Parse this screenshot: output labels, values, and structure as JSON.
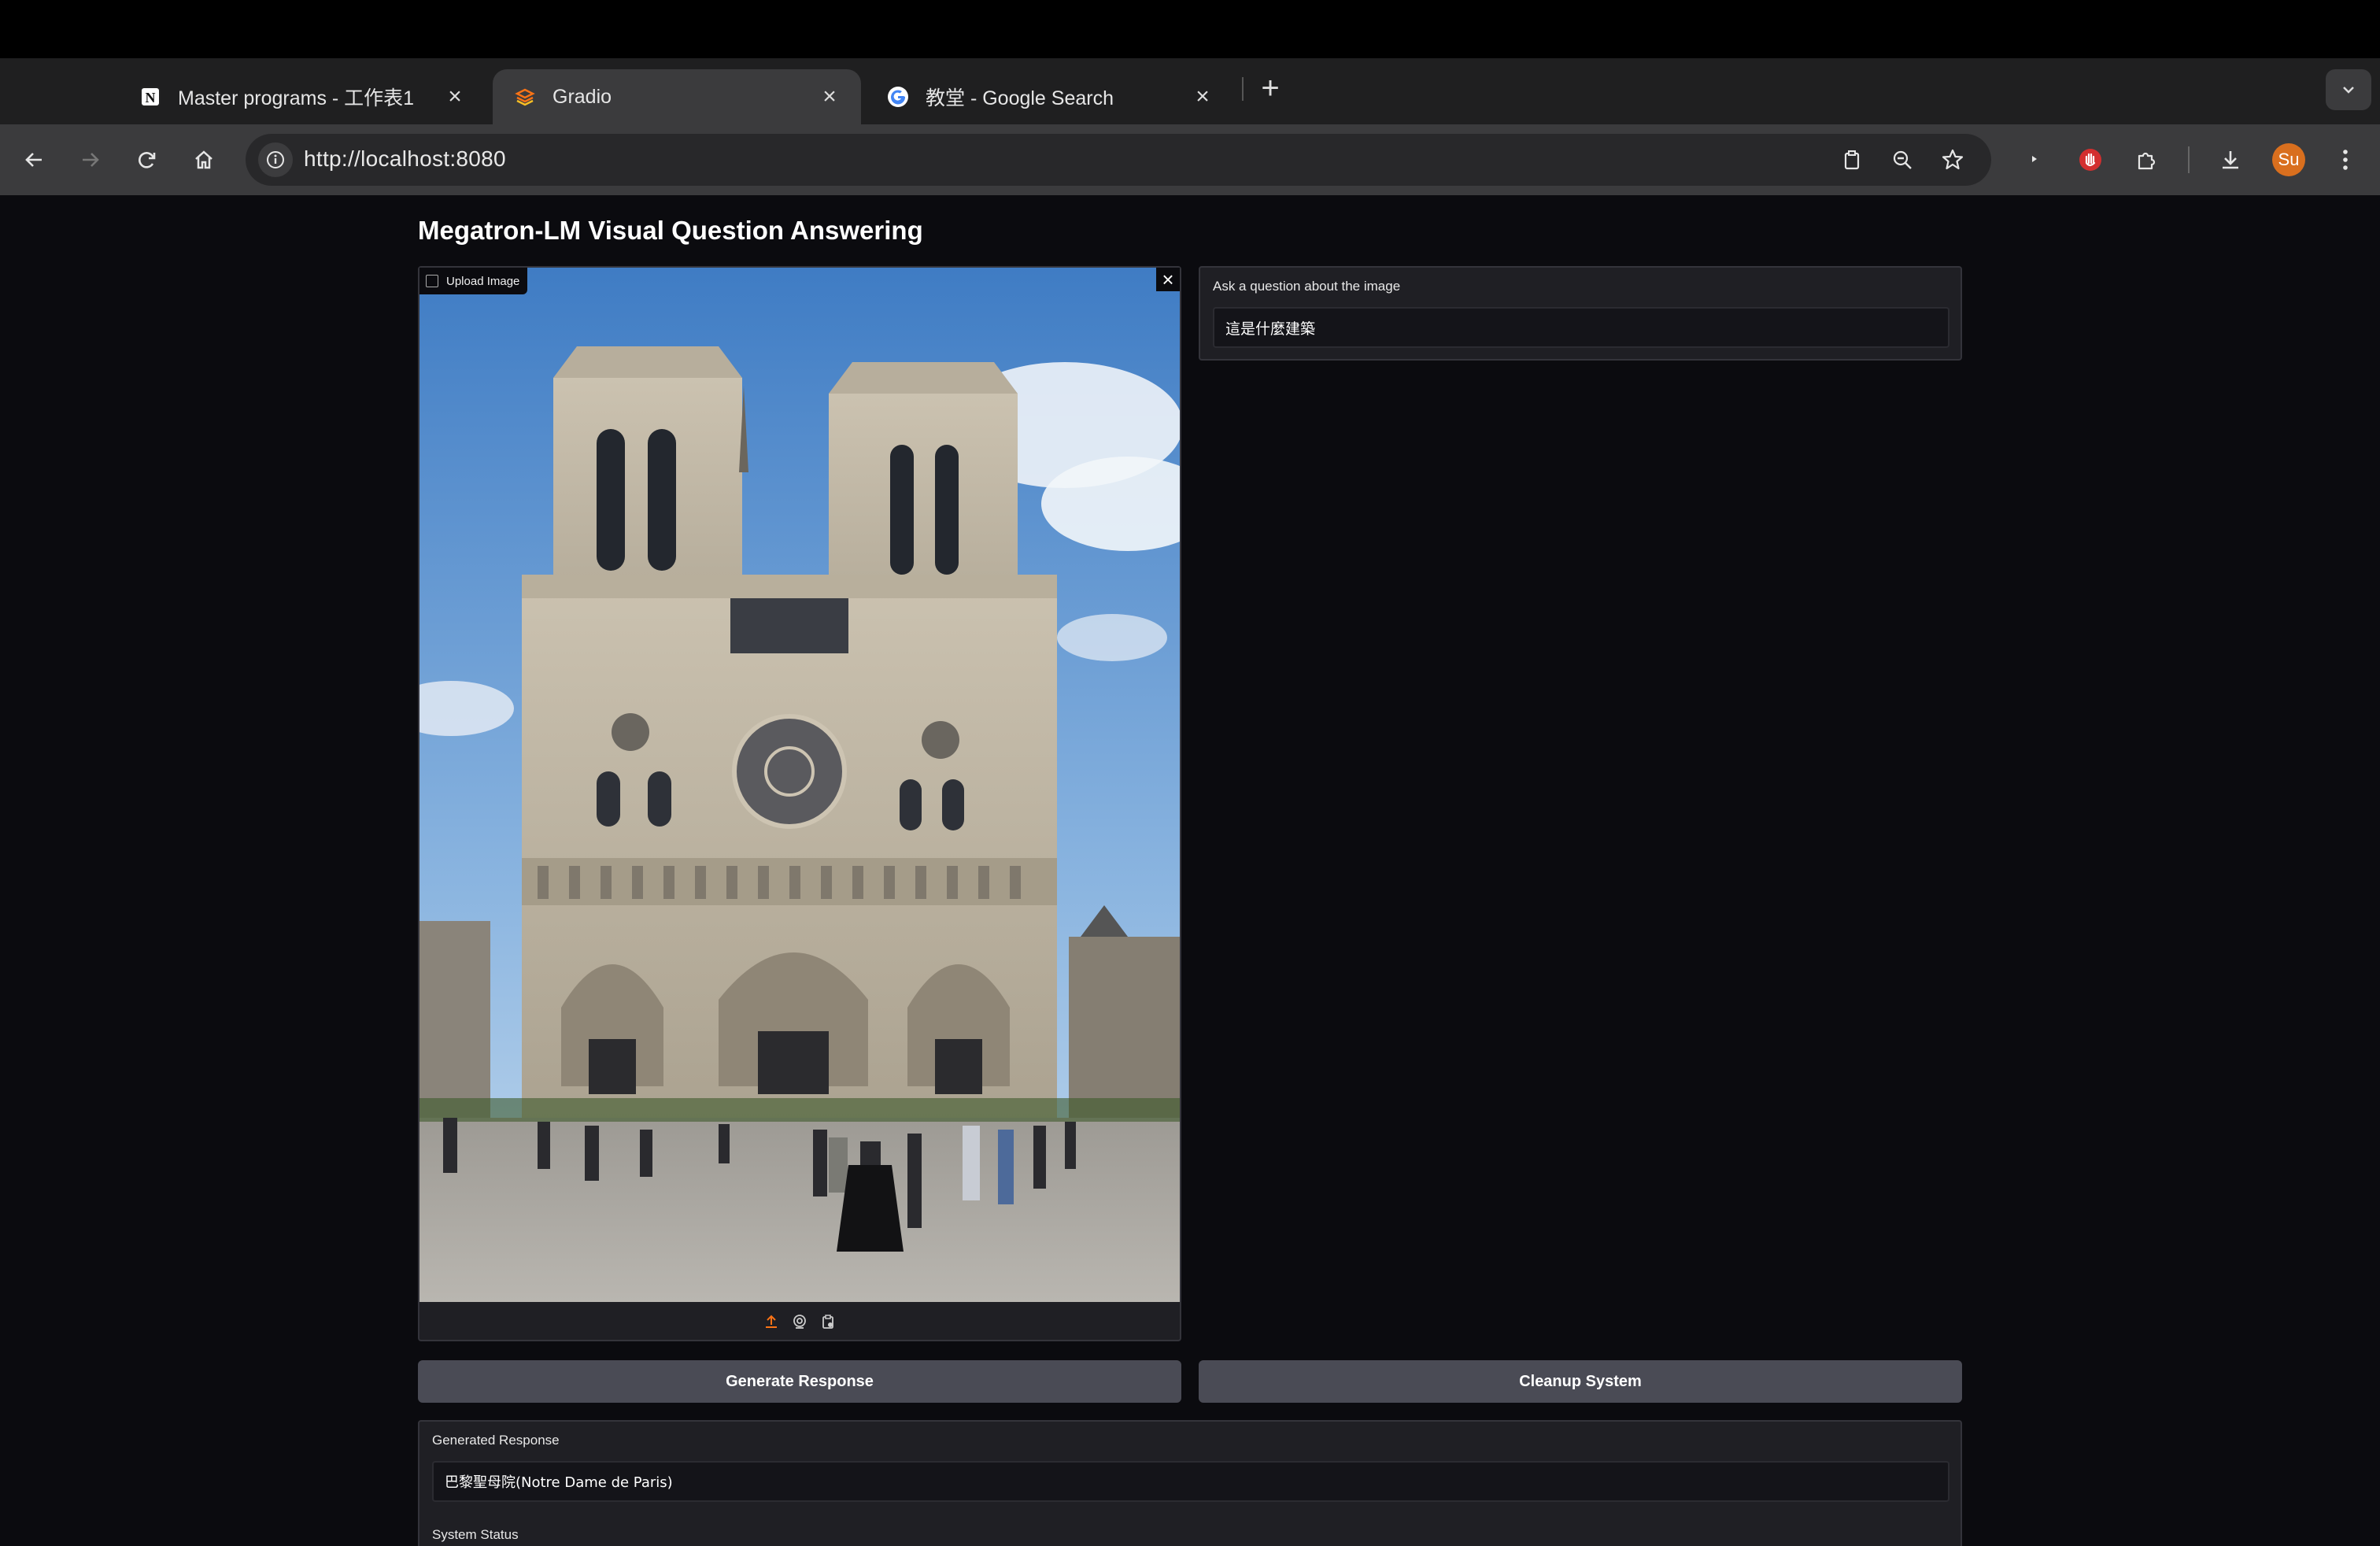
{
  "browser": {
    "tabs": [
      {
        "title": "Master programs - 工作表1",
        "icon": "notion-icon",
        "active": false
      },
      {
        "title": "Gradio",
        "icon": "gradio-icon",
        "active": true
      },
      {
        "title": "教堂 - Google Search",
        "icon": "google-icon",
        "active": false
      }
    ],
    "url": "http://localhost:8080",
    "profile_initials": "Su",
    "profile_color": "#d96f1e"
  },
  "app": {
    "title": "Megatron-LM Visual Question Answering",
    "image_panel": {
      "label": "Upload Image",
      "image_icon": "image-icon",
      "tools": [
        "upload-icon",
        "webcam-icon",
        "clipboard-icon"
      ]
    },
    "question": {
      "label": "Ask a question about the image",
      "value": "這是什麼建築"
    },
    "buttons": {
      "generate": "Generate Response",
      "cleanup": "Cleanup System"
    },
    "response": {
      "label": "Generated Response",
      "value": "巴黎聖母院(Notre Dame de Paris)"
    },
    "status": {
      "label": "System Status"
    }
  },
  "colors": {
    "page_bg": "#0b0b0f",
    "panel_bg": "#1f1f24",
    "button_bg": "#4a4b55",
    "accent_orange": "#f97316"
  }
}
